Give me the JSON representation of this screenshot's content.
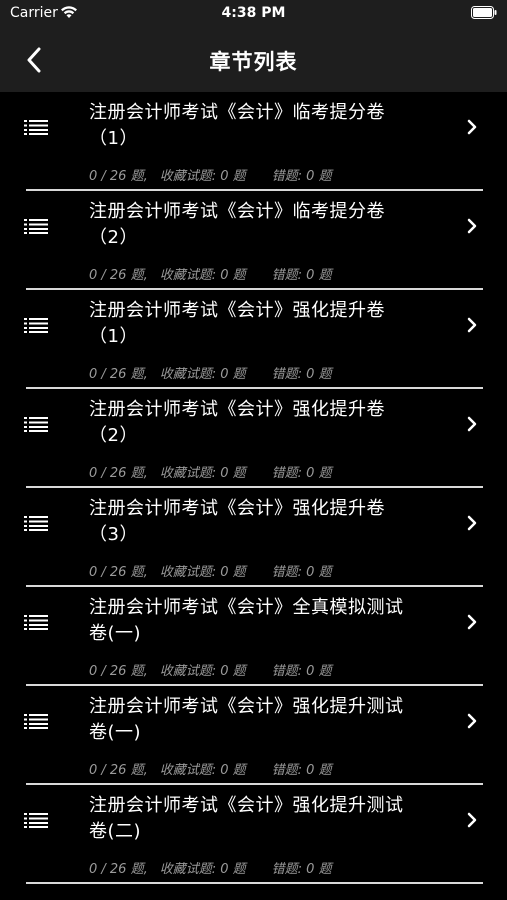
{
  "status_bar": {
    "carrier": "Carrier",
    "time": "4:38 PM"
  },
  "nav": {
    "title": "章节列表",
    "back_icon": "chevron-left-icon"
  },
  "colors": {
    "background": "#000000",
    "bar": "#1e1e1e",
    "text": "#ffffff",
    "subtext": "#9a9a9a",
    "divider": "#d8d8d8"
  },
  "chapters": [
    {
      "title": "注册会计师考试《会计》临考提分卷（1）",
      "progress": "0 / 26 题,",
      "favorites": "收藏试题: 0 题",
      "errors": "错题: 0 题"
    },
    {
      "title": "注册会计师考试《会计》临考提分卷（2）",
      "progress": "0 / 26 题,",
      "favorites": "收藏试题: 0 题",
      "errors": "错题: 0 题"
    },
    {
      "title": "注册会计师考试《会计》强化提升卷（1）",
      "progress": "0 / 26 题,",
      "favorites": "收藏试题: 0 题",
      "errors": "错题: 0 题"
    },
    {
      "title": "注册会计师考试《会计》强化提升卷（2）",
      "progress": "0 / 26 题,",
      "favorites": "收藏试题: 0 题",
      "errors": "错题: 0 题"
    },
    {
      "title": "注册会计师考试《会计》强化提升卷（3）",
      "progress": "0 / 26 题,",
      "favorites": "收藏试题: 0 题",
      "errors": "错题: 0 题"
    },
    {
      "title": "注册会计师考试《会计》全真模拟测试卷(一)",
      "progress": "0 / 26 题,",
      "favorites": "收藏试题: 0 题",
      "errors": "错题: 0 题"
    },
    {
      "title": "注册会计师考试《会计》强化提升测试卷(一)",
      "progress": "0 / 26 题,",
      "favorites": "收藏试题: 0 题",
      "errors": "错题: 0 题"
    },
    {
      "title": "注册会计师考试《会计》强化提升测试卷(二)",
      "progress": "0 / 26 题,",
      "favorites": "收藏试题: 0 题",
      "errors": "错题: 0 题"
    }
  ]
}
